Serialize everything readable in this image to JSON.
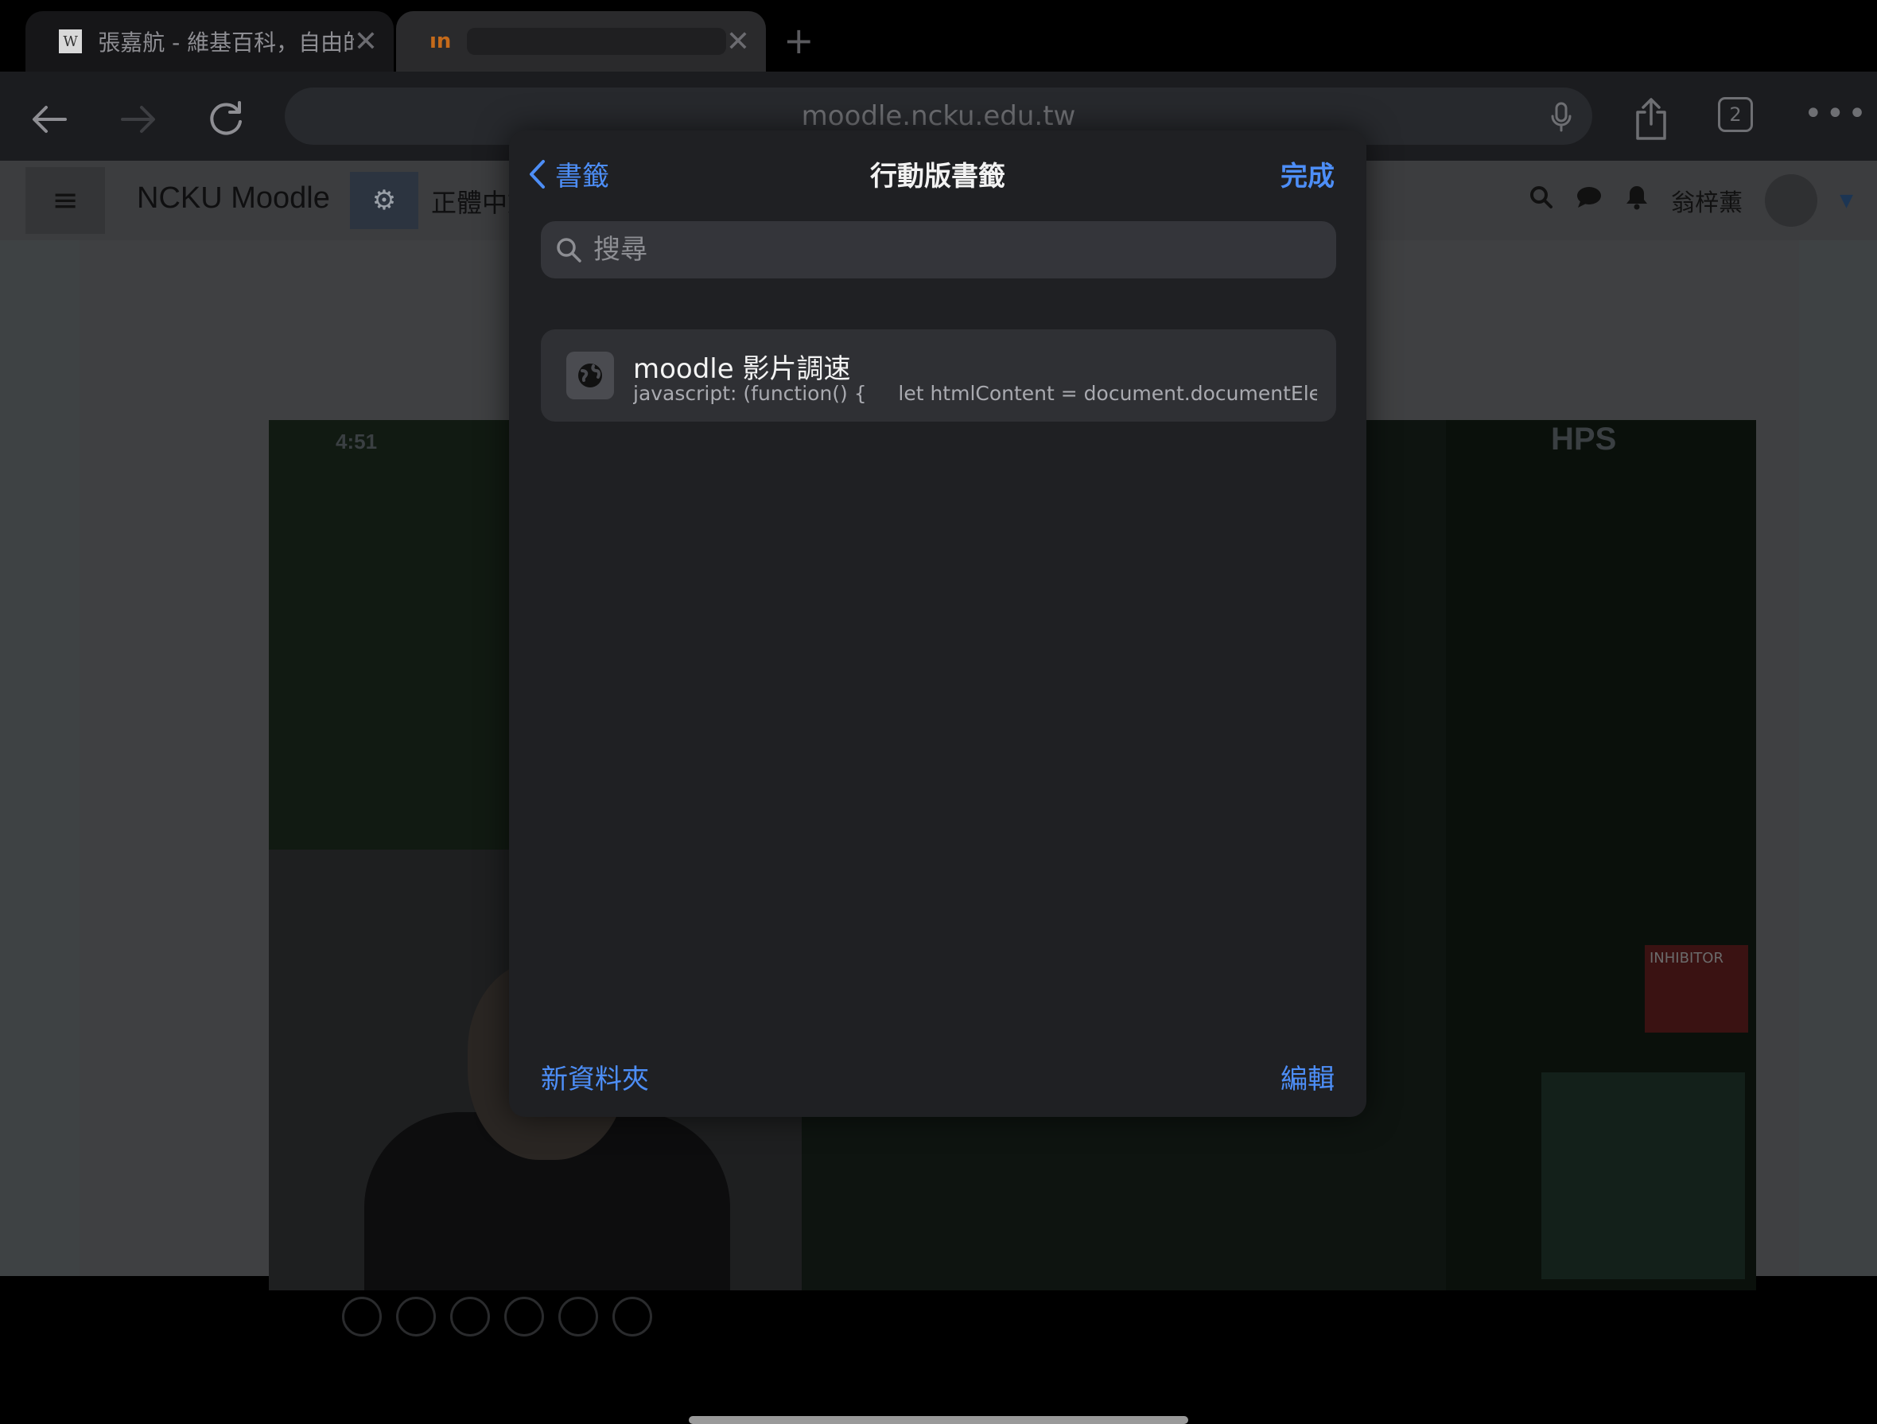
{
  "tabs": [
    {
      "favicon": "W",
      "title": "張嘉航 - 維基百科，自由的"
    },
    {
      "favicon": "ın",
      "title": ""
    }
  ],
  "toolbar": {
    "url": "moodle.ncku.edu.tw",
    "tab_count": "2"
  },
  "moodle": {
    "brand": "NCKU Moodle",
    "language": "正體中文",
    "user_name": "翁梓薰",
    "video_timer": "4:51",
    "video_team": "HPS",
    "inhibitor_label": "INHIBITOR"
  },
  "sheet": {
    "back_label": "書籤",
    "title": "行動版書籤",
    "done_label": "完成",
    "search_placeholder": "搜尋",
    "search_value": "",
    "bookmarks": [
      {
        "name": "moodle 影片調速",
        "url": "javascript: (function() {     let htmlContent = document.documentEle..."
      }
    ],
    "new_folder_label": "新資料夾",
    "edit_label": "編輯"
  },
  "colors": {
    "accent": "#4d8ef7",
    "sheet_bg": "#1f2023",
    "row_bg": "#2f3034"
  }
}
